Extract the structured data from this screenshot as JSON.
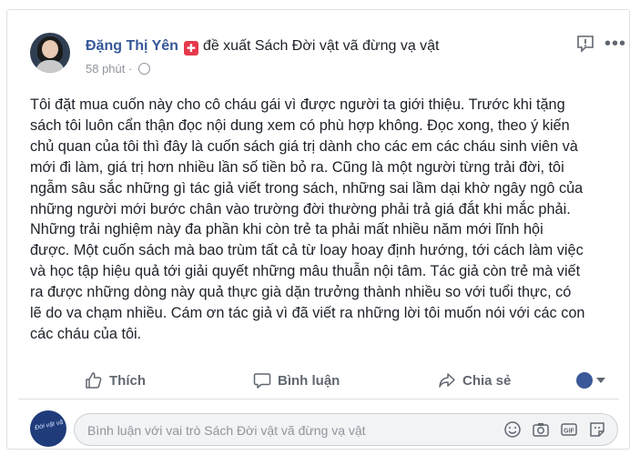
{
  "post": {
    "author": "Đặng Thị Yên",
    "action_text": "đề xuất Sách Đời vật vã đừng vạ vật",
    "time": "58 phút",
    "meta_sep": "·",
    "body_lines": [
      "Tôi đặt mua cuốn này cho cô cháu gái vì được người ta giới thiệu. Trước khi tặng",
      "sách tôi luôn cẩn thận đọc nội dung xem có phù hợp không. Đọc xong, theo ý kiến",
      "chủ quan của tôi thì đây là cuốn sách giá trị dành cho các em các cháu sinh viên và",
      "mới đi làm, giá trị hơn nhiều lần số tiền bỏ ra. Cũng là một người từng trải đời, tôi",
      "ngẫm sâu sắc những gì tác giả viết trong sách, những sai lầm dại khờ ngây ngô của",
      "những người mới bước chân vào trường đời thường phải trả giá đắt khi mắc phải.",
      "Những trải nghiệm này đa phần khi còn trẻ ta phải mất nhiều năm mới lĩnh hội",
      "được. Một cuốn sách mà bao trùm tất cả từ loay hoay định hướng, tới cách làm việc",
      "và học tập hiệu quả tới giải quyết những mâu thuẫn nội tâm. Tác giả còn trẻ mà viết",
      "ra được những dòng này quả thực già dặn trưởng thành nhiều so với tuổi thực, có",
      "lẽ do va chạm nhiều. Cám ơn tác giả vì đã viết ra những lời tôi muốn nói với các con",
      "các cháu của tôi."
    ]
  },
  "actions": {
    "like": "Thích",
    "comment": "Bình luận",
    "share": "Chia sẻ"
  },
  "comment_box": {
    "placeholder": "Bình luận với vai trò Sách Đời vật vã đừng vạ vật"
  },
  "colors": {
    "author": "#365899",
    "text": "#1d2129",
    "muted": "#90949c",
    "badge": "#e5394b"
  }
}
